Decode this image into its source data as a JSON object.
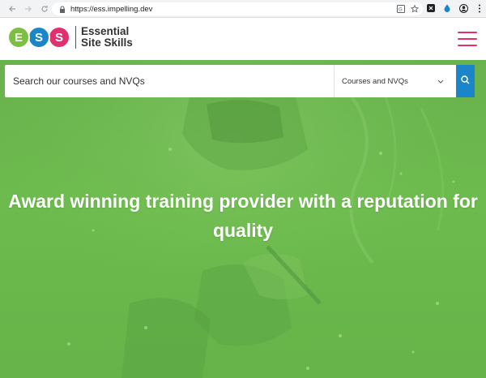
{
  "browser": {
    "url": "https://ess.impelling.dev"
  },
  "header": {
    "logo_letters": [
      "E",
      "S",
      "S"
    ],
    "logo_line1": "Essential",
    "logo_line2": "Site Skills"
  },
  "search": {
    "placeholder": "Search our courses and NVQs",
    "selected_option": "Courses and NVQs"
  },
  "hero": {
    "title": "Award winning training provider with a reputation for quality"
  },
  "colors": {
    "brand_green": "#7bc043",
    "brand_blue": "#1a86c9",
    "brand_pink": "#e0306f",
    "hero_green": "#6dbb4e"
  }
}
